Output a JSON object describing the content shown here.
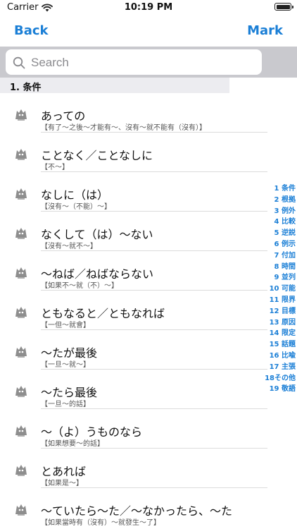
{
  "status": {
    "carrier": "Carrier",
    "time": "10:19 PM"
  },
  "nav": {
    "back_label": "Back",
    "mark_label": "Mark"
  },
  "search": {
    "placeholder": "Search"
  },
  "section": {
    "title": "1.  条件"
  },
  "items": [
    {
      "title": "あっての",
      "subtitle": "【有了～之後～才能有～、沒有～就不能有（沒有）】"
    },
    {
      "title": "ことなく／ことなしに",
      "subtitle": "【不～】"
    },
    {
      "title": "なしに（は）",
      "subtitle": "【沒有～（不能）～】"
    },
    {
      "title": "なくして（は）～ない",
      "subtitle": "【沒有～就不～】"
    },
    {
      "title": "～ねば／ねばならない",
      "subtitle": "【如果不～就（不）～】"
    },
    {
      "title": "ともなると／ともなれば",
      "subtitle": "【一但～就會】"
    },
    {
      "title": "～たが最後",
      "subtitle": "【一旦～就～】"
    },
    {
      "title": "～たら最後",
      "subtitle": "【一旦～的話】"
    },
    {
      "title": "～（よ）うものなら",
      "subtitle": "【如果想要～的話】"
    },
    {
      "title": "とあれば",
      "subtitle": "【如果是～】"
    },
    {
      "title": "～ていたら～た／～なかったら、～た",
      "subtitle": "【如果當時有（沒有）～就發生～了】"
    }
  ],
  "index": [
    "1 条件",
    "2 根拠",
    "3 例外",
    "4 比較",
    "5 逆説",
    "6 例示",
    "7 付加",
    "8 時間",
    "9 並列",
    "10 可能",
    "11 限界",
    "12 目標",
    "13 原因",
    "14 限定",
    "15 話題",
    "16 比喩",
    "17 主張",
    "18その他",
    "19 敬語"
  ],
  "colors": {
    "accent": "#1b7fd6",
    "search_bar_bg": "#c9c9ce",
    "section_bg": "#ececf0"
  }
}
